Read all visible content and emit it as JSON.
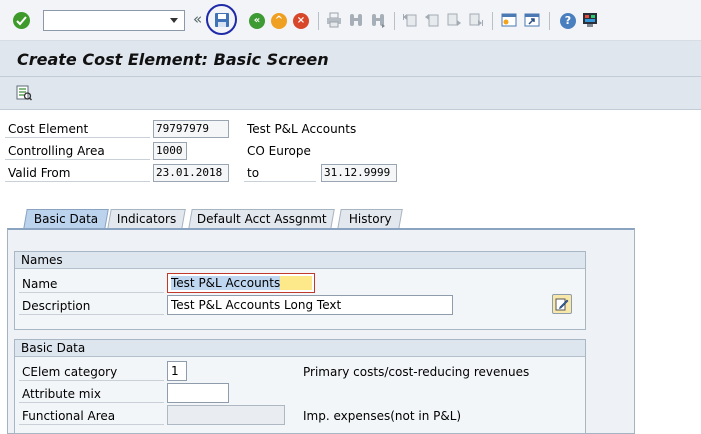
{
  "toolbar": {
    "command_field_value": "",
    "icons": [
      "ok-icon",
      "collapse-icon",
      "save-icon",
      "back-icon",
      "exit-icon",
      "cancel-icon",
      "print-icon",
      "find-icon",
      "find-next-icon",
      "first-page-icon",
      "previous-page-icon",
      "next-page-icon",
      "last-page-icon",
      "create-session-icon",
      "shortcut-icon",
      "help-icon",
      "customize-layout-icon"
    ],
    "collapse_glyph": "«",
    "help_glyph": "?"
  },
  "title": "Create Cost Element: Basic Screen",
  "header": {
    "cost_element_label": "Cost Element",
    "cost_element_value": "79797979",
    "cost_element_text": "Test P&L Accounts",
    "controlling_area_label": "Controlling Area",
    "controlling_area_value": "1000",
    "controlling_area_text": "CO Europe",
    "valid_from_label": "Valid From",
    "valid_from_value": "23.01.2018",
    "to_label": "to",
    "valid_to_value": "31.12.9999"
  },
  "tabs": [
    {
      "label": "Basic Data",
      "active": true
    },
    {
      "label": "Indicators",
      "active": false
    },
    {
      "label": "Default Acct Assgnmt",
      "active": false
    },
    {
      "label": "History",
      "active": false
    }
  ],
  "names_group": {
    "title": "Names",
    "name_label": "Name",
    "name_value": "Test P&L Accounts",
    "description_label": "Description",
    "description_value": "Test P&L Accounts Long Text"
  },
  "basic_data_group": {
    "title": "Basic Data",
    "celem_category_label": "CElem category",
    "celem_category_value": "1",
    "celem_category_text": "Primary costs/cost-reducing revenues",
    "attribute_mix_label": "Attribute mix",
    "attribute_mix_value": "",
    "functional_area_label": "Functional Area",
    "functional_area_value": "",
    "functional_area_text": "Imp. expenses(not in P&L)"
  },
  "colors": {
    "toolbar_bg": "#f2f4f7",
    "title_bg": "#dfe6ee",
    "active_tab": "#bcd3ee",
    "save_highlight_ring": "#1f2aa8"
  }
}
